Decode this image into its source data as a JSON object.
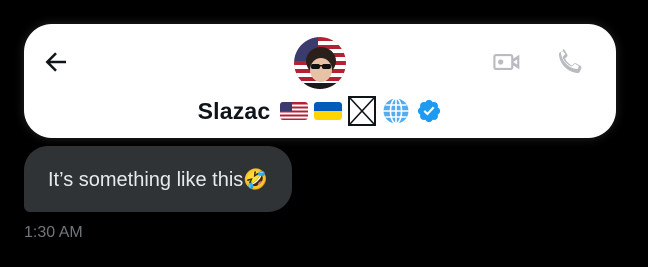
{
  "header": {
    "display_name": "Slazac",
    "back_icon": "arrow-left-icon",
    "video_icon": "video-camera-icon",
    "call_icon": "phone-icon",
    "name_badges": [
      "us-flag-emoji",
      "ukraine-flag-emoji",
      "missing-glyph-box",
      "globe-emoji",
      "verified-badge-icon"
    ]
  },
  "message": {
    "text": "It’s something like this🤣",
    "timestamp": "1:30 AM"
  },
  "colors": {
    "background": "#000000",
    "header_bg": "#ffffff",
    "bubble_bg": "#2f3336",
    "bubble_text": "#e7e9ea",
    "timestamp": "#71767b",
    "verified": "#1d9bf0",
    "icon_muted": "#b8bcc0"
  }
}
